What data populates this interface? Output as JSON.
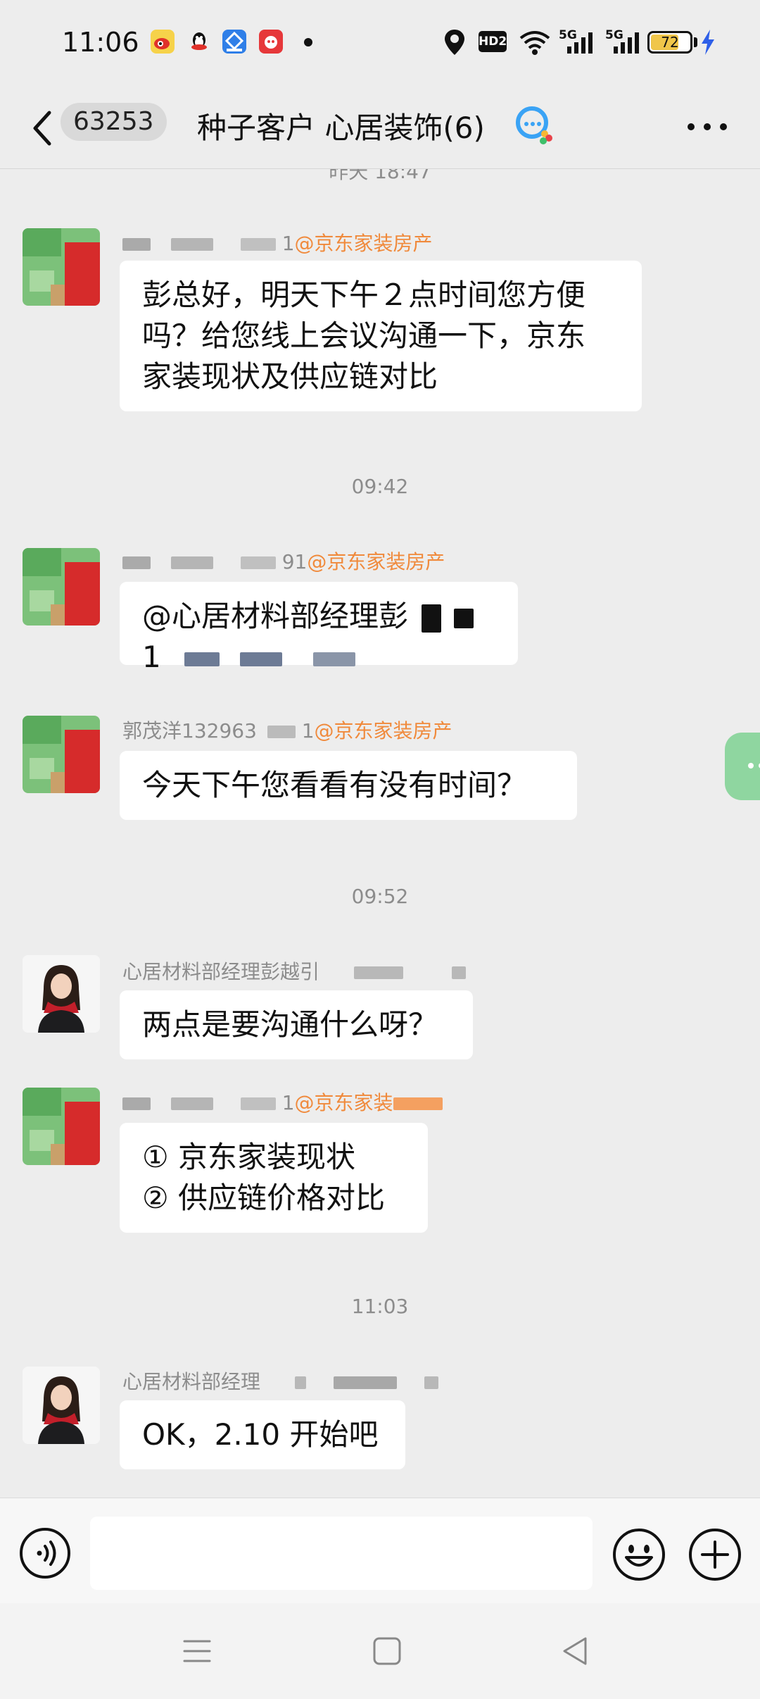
{
  "status_bar": {
    "time": "11:06",
    "network_1": "5G",
    "network_2": "5G",
    "hd_label": "HD2",
    "battery_level": "72",
    "battery_fraction": 0.72
  },
  "header": {
    "unread_count": "63253",
    "title": "种子客户 心居装饰(6)"
  },
  "messages": {
    "partial_timestamp": "昨天 18:47",
    "m1": {
      "sender_suffix": "1",
      "org": "@京东家装房产",
      "text_line1": "彭总好，明天下午２点时间您方便",
      "text_line2": "吗？给您线上会议沟通一下，京东",
      "text_line3": "家装现状及供应链对比"
    },
    "ts2": "09:42",
    "m2": {
      "sender_suffix": "91",
      "org": "@京东家装房产",
      "text_line1": "@心居材料部经理彭",
      "text_line2": "1"
    },
    "m3": {
      "sender": "郭茂洋132963",
      "sender_suffix": "1",
      "org": "@京东家装房产",
      "text": "今天下午您看看有没有时间？"
    },
    "ts3": "09:52",
    "m4": {
      "sender": "心居材料部经理彭越引",
      "text": "两点是要沟通什么呀？"
    },
    "m5": {
      "sender_suffix": "1",
      "org": "@京东家装",
      "text_line1": "① 京东家装现状",
      "text_line2": "② 供应链价格对比"
    },
    "ts4": "11:03",
    "m6": {
      "sender": "心居材料部经理",
      "text": "OK，2.10 开始吧"
    }
  },
  "input": {
    "placeholder": ""
  },
  "icons": {
    "back": "chevron-left-icon",
    "more": "more-dots-icon",
    "voice": "voice-icon",
    "emoji": "emoji-icon",
    "plus": "plus-icon",
    "nav_menu": "menu-icon",
    "nav_home": "home-icon",
    "nav_back": "back-triangle-icon"
  },
  "colors": {
    "background": "#ededed",
    "bubble": "#ffffff",
    "org_tag": "#f08a3c",
    "timestamp": "#8c8c8c",
    "battery_fill": "#f0c64a",
    "floating_tab": "#8fd6a0"
  }
}
